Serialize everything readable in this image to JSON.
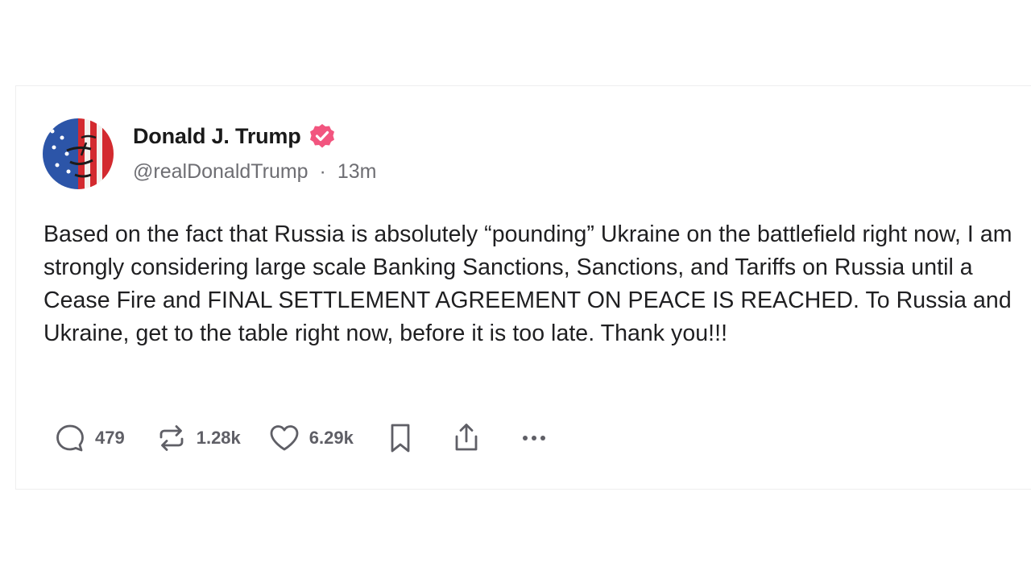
{
  "post": {
    "author": {
      "display_name": "Donald J. Trump",
      "handle": "@realDonaldTrump",
      "separator": "·",
      "time_ago": "13m",
      "verified": true,
      "avatar_icon": "american-flag-face-avatar"
    },
    "text": "Based on the fact that Russia is absolutely “pounding” Ukraine on the battlefield right now, I am strongly considering large scale Banking Sanctions, Sanctions, and Tariffs on Russia until a Cease Fire and FINAL SETTLEMENT AGREEMENT ON PEACE IS REACHED. To Russia and Ukraine, get to the table right now, before it is too late. Thank you!!!",
    "actions": {
      "replies": "479",
      "reposts": "1.28k",
      "likes": "6.29k"
    }
  },
  "colors": {
    "verified_badge": "#f2557f",
    "text_primary": "#1f1f21",
    "text_secondary": "#6e6e73",
    "icon": "#5f5f66"
  },
  "icons": [
    "reply-icon",
    "repost-icon",
    "like-icon",
    "bookmark-icon",
    "share-icon",
    "more-icon",
    "verified-icon"
  ]
}
